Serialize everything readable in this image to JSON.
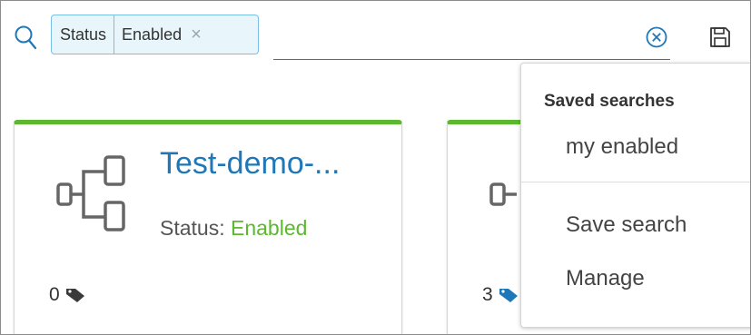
{
  "search": {
    "filter_chip": {
      "key": "Status",
      "value": "Enabled",
      "remove_glyph": "×"
    },
    "input_value": "",
    "icons": {
      "search": "search-icon",
      "clear": "clear-circle-icon",
      "save": "floppy-disk-icon"
    }
  },
  "cards": [
    {
      "title": "Test-demo-...",
      "status_label": "Status:",
      "status_value": "Enabled",
      "tag_count": "0",
      "tag_color": "#3a3a3a",
      "accent_color": "#5cb82e"
    },
    {
      "tag_count": "3",
      "tag_color": "#1f77b7",
      "accent_color": "#5cb82e"
    }
  ],
  "dropdown": {
    "header": "Saved searches",
    "saved_items": [
      "my enabled"
    ],
    "actions": [
      "Save search",
      "Manage"
    ]
  },
  "colors": {
    "link": "#1f77b7",
    "success": "#5cb82e",
    "chip_border": "#79c1e4",
    "chip_bg": "#e8f5fb"
  }
}
